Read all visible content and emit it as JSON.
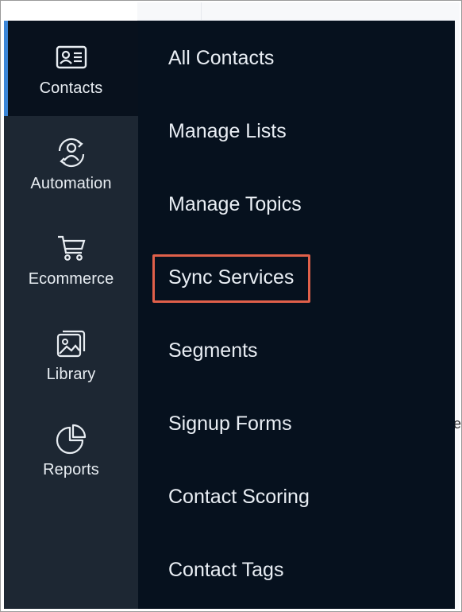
{
  "sidebar": {
    "items": [
      {
        "label": "Contacts",
        "icon": "contact-card-icon",
        "active": true
      },
      {
        "label": "Automation",
        "icon": "automation-icon",
        "active": false
      },
      {
        "label": "Ecommerce",
        "icon": "shopping-cart-icon",
        "active": false
      },
      {
        "label": "Library",
        "icon": "image-library-icon",
        "active": false
      },
      {
        "label": "Reports",
        "icon": "pie-chart-icon",
        "active": false
      }
    ],
    "accent_color": "#3b86d8",
    "background_color": "#1d2733",
    "active_background_color": "#08111d"
  },
  "submenu": {
    "items": [
      {
        "label": "All Contacts"
      },
      {
        "label": "Manage Lists"
      },
      {
        "label": "Manage Topics"
      },
      {
        "label": "Sync Services",
        "highlighted": true
      },
      {
        "label": "Segments"
      },
      {
        "label": "Signup Forms"
      },
      {
        "label": "Contact Scoring"
      },
      {
        "label": "Contact Tags"
      }
    ],
    "background_color": "#06111e",
    "highlight_color": "#e0604a"
  },
  "background_page": {
    "partial_text": "e"
  }
}
